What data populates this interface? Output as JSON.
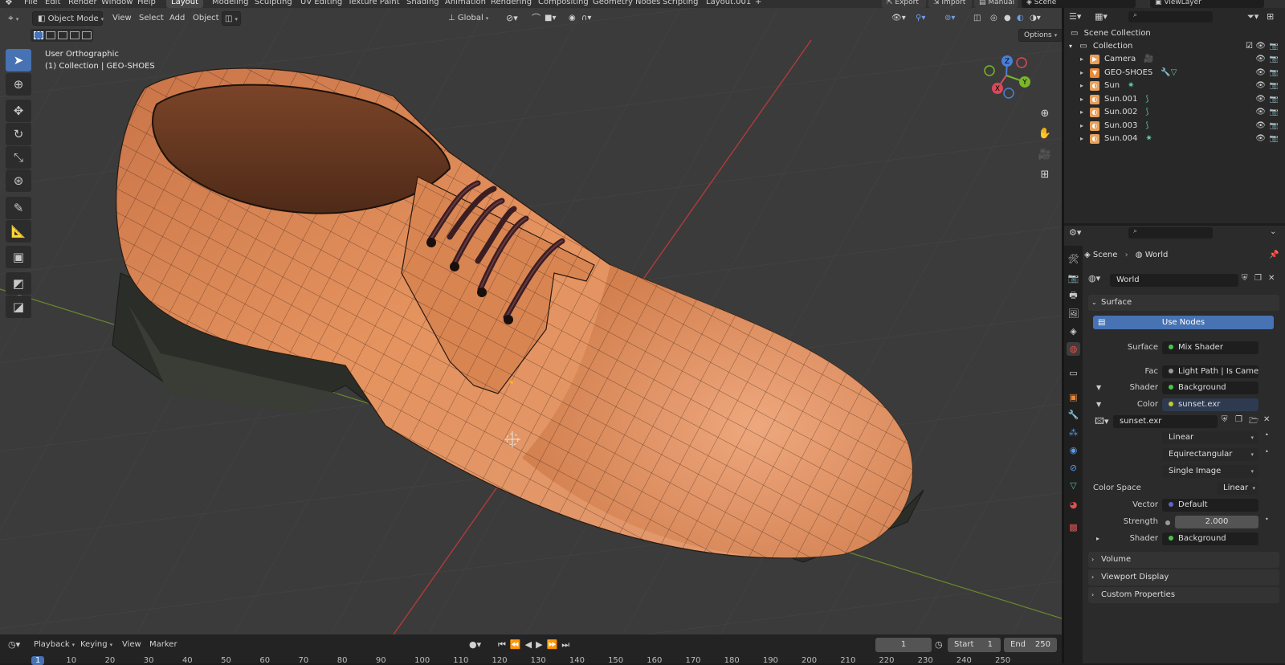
{
  "topbar": {
    "menus": [
      "File",
      "Edit",
      "Render",
      "Window",
      "Help"
    ],
    "workspaces": [
      "Layout",
      "Modeling",
      "Sculpting",
      "UV Editing",
      "Texture Paint",
      "Shading",
      "Animation",
      "Rendering",
      "Compositing",
      "Geometry Nodes",
      "Scripting",
      "Layout.001"
    ],
    "active_workspace": "Layout",
    "add_workspace": "+",
    "export_label": "Export",
    "import_label": "Import",
    "manual_label": "Manual",
    "scene_name": "Scene",
    "viewlayer_name": "ViewLayer"
  },
  "viewport": {
    "mode": "Object Mode",
    "menus": [
      "View",
      "Select",
      "Add",
      "Object"
    ],
    "transform_orientation": "Global",
    "options_label": "Options",
    "view_name": "User Orthographic",
    "collection_info": "(1) Collection | GEO-SHOES",
    "tools": [
      "select-box-tool",
      "cursor-tool",
      "move-tool",
      "rotate-tool",
      "scale-tool",
      "transform-tool",
      "annotate-tool",
      "measure-tool",
      "add-cube-tool",
      "extrude-tool",
      "bevel-tool"
    ],
    "gizmo": {
      "z": "Z",
      "y": "Y",
      "x": "X"
    }
  },
  "outliner": {
    "root": "Scene Collection",
    "collection": "Collection",
    "items": [
      {
        "name": "Camera",
        "icon": "camera-icon",
        "data_icon": "camera-data-icon"
      },
      {
        "name": "GEO-SHOES",
        "icon": "mesh-icon",
        "data_icon": "modifier-icon"
      },
      {
        "name": "Sun",
        "icon": "light-icon",
        "data_icon": "sun-data-icon"
      },
      {
        "name": "Sun.001",
        "icon": "light-icon",
        "data_icon": "light-data-icon"
      },
      {
        "name": "Sun.002",
        "icon": "light-icon",
        "data_icon": "light-data-icon"
      },
      {
        "name": "Sun.003",
        "icon": "light-icon",
        "data_icon": "light-data-icon"
      },
      {
        "name": "Sun.004",
        "icon": "light-icon",
        "data_icon": "sun-data-icon"
      }
    ]
  },
  "properties": {
    "breadcrumb_scene": "Scene",
    "breadcrumb_world": "World",
    "world_name": "World",
    "surface_header": "Surface",
    "use_nodes": "Use Nodes",
    "surface_label": "Surface",
    "surface_value": "Mix Shader",
    "fac_label": "Fac",
    "fac_value": "Light Path | Is Camera ...",
    "shader_label": "Shader",
    "shader_value": "Background",
    "color_label": "Color",
    "color_value": "sunset.exr",
    "image_name": "sunset.exr",
    "interpolation": "Linear",
    "projection": "Equirectangular",
    "source": "Single Image",
    "color_space_label": "Color Space",
    "color_space_value": "Linear",
    "vector_label": "Vector",
    "vector_value": "Default",
    "strength_label": "Strength",
    "strength_value": "2.000",
    "shader2_label": "Shader",
    "shader2_value": "Background",
    "volume_header": "Volume",
    "viewport_display_header": "Viewport Display",
    "custom_props_header": "Custom Properties"
  },
  "timeline": {
    "playback": "Playback",
    "keying": "Keying",
    "view": "View",
    "marker": "Marker",
    "current_frame": "1",
    "start_label": "Start",
    "start_value": "1",
    "end_label": "End",
    "end_value": "250",
    "frame_numbers": [
      "1",
      "10",
      "20",
      "30",
      "40",
      "50",
      "60",
      "70",
      "80",
      "90",
      "100",
      "110",
      "120",
      "130",
      "140",
      "150",
      "160",
      "170",
      "180",
      "190",
      "200",
      "210",
      "220",
      "230",
      "240",
      "250"
    ]
  },
  "colors": {
    "accent": "#4772b3",
    "shoe": "#d98552",
    "sole": "#2a2d27",
    "viewport_bg": "#3b3b3b"
  }
}
